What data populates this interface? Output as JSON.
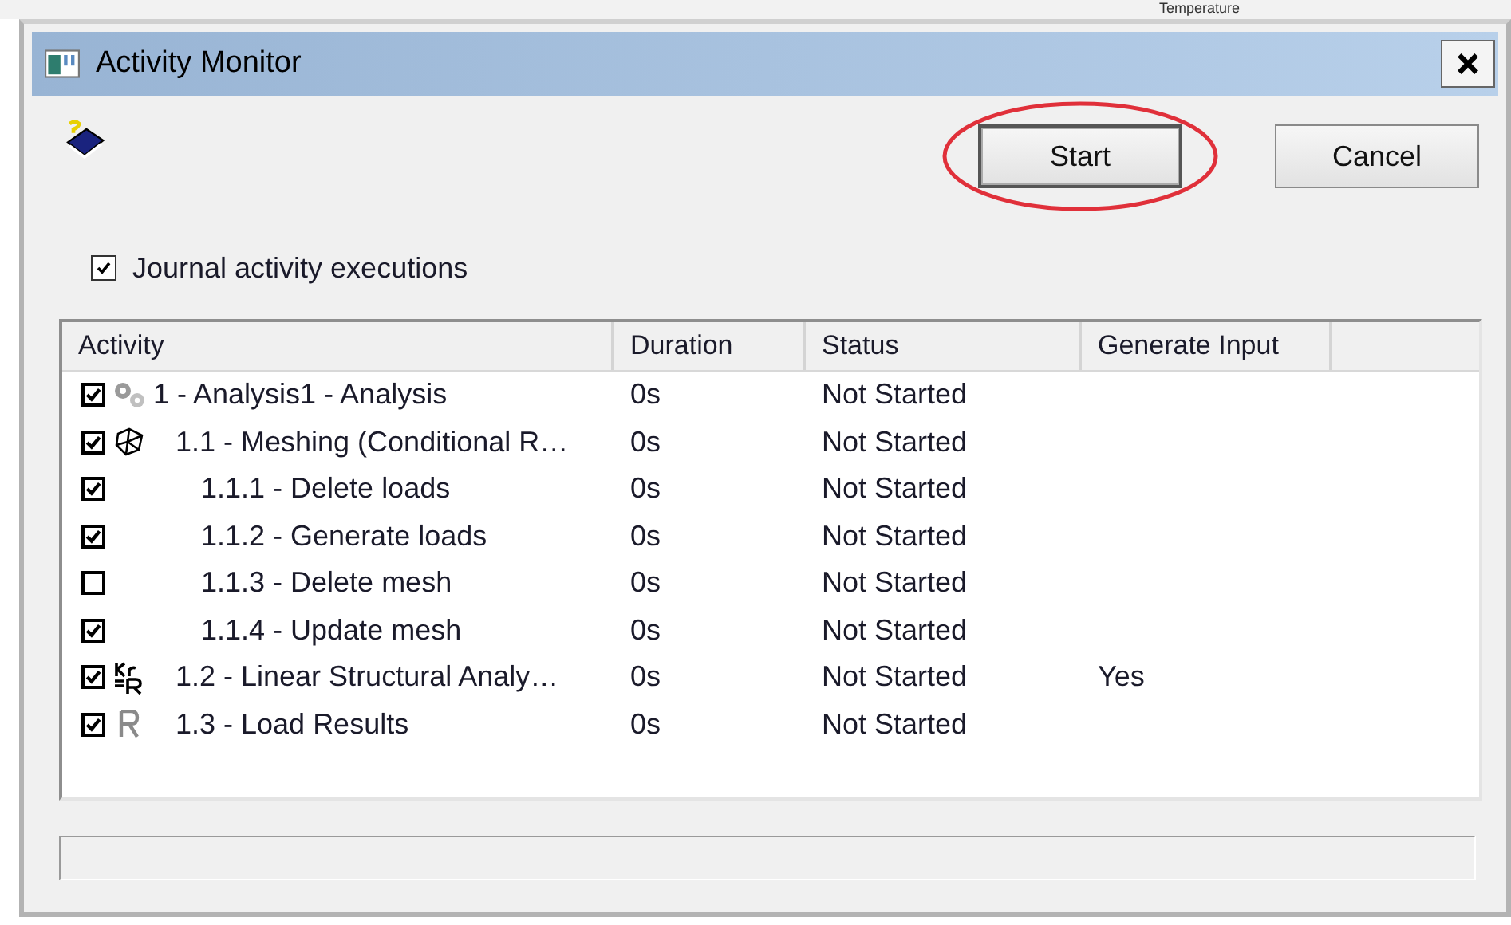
{
  "background": {
    "label": "Temperature"
  },
  "window": {
    "title": "Activity Monitor"
  },
  "buttons": [
    {
      "label": "Start",
      "highlighted": true
    },
    {
      "label": "Cancel",
      "highlighted": false
    }
  ],
  "journal": {
    "label": "Journal activity executions",
    "checked": true
  },
  "table": {
    "columns": [
      "Activity",
      "Duration",
      "Status",
      "Generate Input"
    ],
    "rows": [
      {
        "kind": "analysis",
        "label": "1 - Analysis1 - Analysis",
        "checked": true,
        "duration": "0s",
        "status": "Not Started",
        "children": [
          {
            "kind": "mesh",
            "label": "1.1 - Meshing (Conditional R…",
            "checked": true,
            "duration": "0s",
            "status": "Not Started",
            "children": [
              {
                "label": "1.1.1 - Delete loads",
                "checked": true,
                "duration": "0s",
                "status": "Not Started"
              },
              {
                "label": "1.1.2 - Generate loads",
                "checked": true,
                "duration": "0s",
                "status": "Not Started"
              },
              {
                "label": "1.1.3 - Delete mesh",
                "checked": false,
                "duration": "0s",
                "status": "Not Started"
              },
              {
                "label": "1.1.4 - Update mesh",
                "checked": true,
                "duration": "0s",
                "status": "Not Started"
              }
            ]
          },
          {
            "kind": "solve",
            "label": "1.2 - Linear Structural Analy…",
            "checked": true,
            "duration": "0s",
            "status": "Not Started",
            "generate_input": "Yes"
          },
          {
            "kind": "results",
            "label": "1.3 - Load Results",
            "checked": true,
            "duration": "0s",
            "status": "Not Started"
          }
        ]
      }
    ]
  }
}
